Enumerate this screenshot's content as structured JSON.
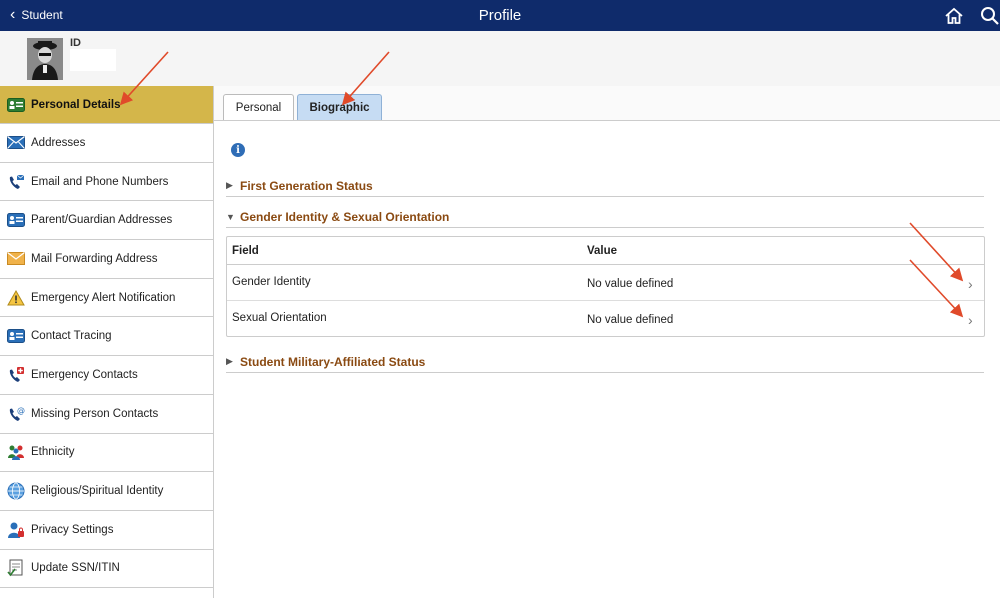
{
  "header": {
    "back_label": "Student",
    "title": "Profile",
    "home_icon": "home-icon",
    "search_icon": "search-icon",
    "bg_color": "#0f2b6b"
  },
  "profile": {
    "id_label": "ID"
  },
  "sidebar": {
    "active_color": "#d4b64a",
    "items": [
      {
        "label": "Personal Details",
        "icon": "id-card-icon"
      },
      {
        "label": "Addresses",
        "icon": "envelope-icon"
      },
      {
        "label": "Email and Phone Numbers",
        "icon": "phone-email-icon"
      },
      {
        "label": "Parent/Guardian Addresses",
        "icon": "address-card-icon"
      },
      {
        "label": "Mail Forwarding Address",
        "icon": "mail-forward-icon"
      },
      {
        "label": "Emergency Alert Notification",
        "icon": "warning-icon"
      },
      {
        "label": "Contact Tracing",
        "icon": "contact-card-icon"
      },
      {
        "label": "Emergency Contacts",
        "icon": "emergency-phone-icon"
      },
      {
        "label": "Missing Person Contacts",
        "icon": "phone-at-icon"
      },
      {
        "label": "Ethnicity",
        "icon": "people-icon"
      },
      {
        "label": "Religious/Spiritual Identity",
        "icon": "globe-icon"
      },
      {
        "label": "Privacy Settings",
        "icon": "user-lock-icon"
      },
      {
        "label": "Update SSN/ITIN",
        "icon": "document-check-icon"
      }
    ]
  },
  "tabs": [
    {
      "label": "Personal"
    },
    {
      "label": "Biographic"
    }
  ],
  "sections": {
    "first_gen": "First Generation Status",
    "gender": "Gender Identity & Sexual Orientation",
    "military": "Student Military-Affiliated Status"
  },
  "grid": {
    "col_field": "Field",
    "col_value": "Value",
    "rows": [
      {
        "field": "Gender Identity",
        "value": "No value defined"
      },
      {
        "field": "Sexual Orientation",
        "value": "No value defined"
      }
    ]
  },
  "colors": {
    "section_title": "#8a4a12",
    "tab_selected": "#c6dcf3",
    "annotation_arrow": "#e04a2a"
  }
}
